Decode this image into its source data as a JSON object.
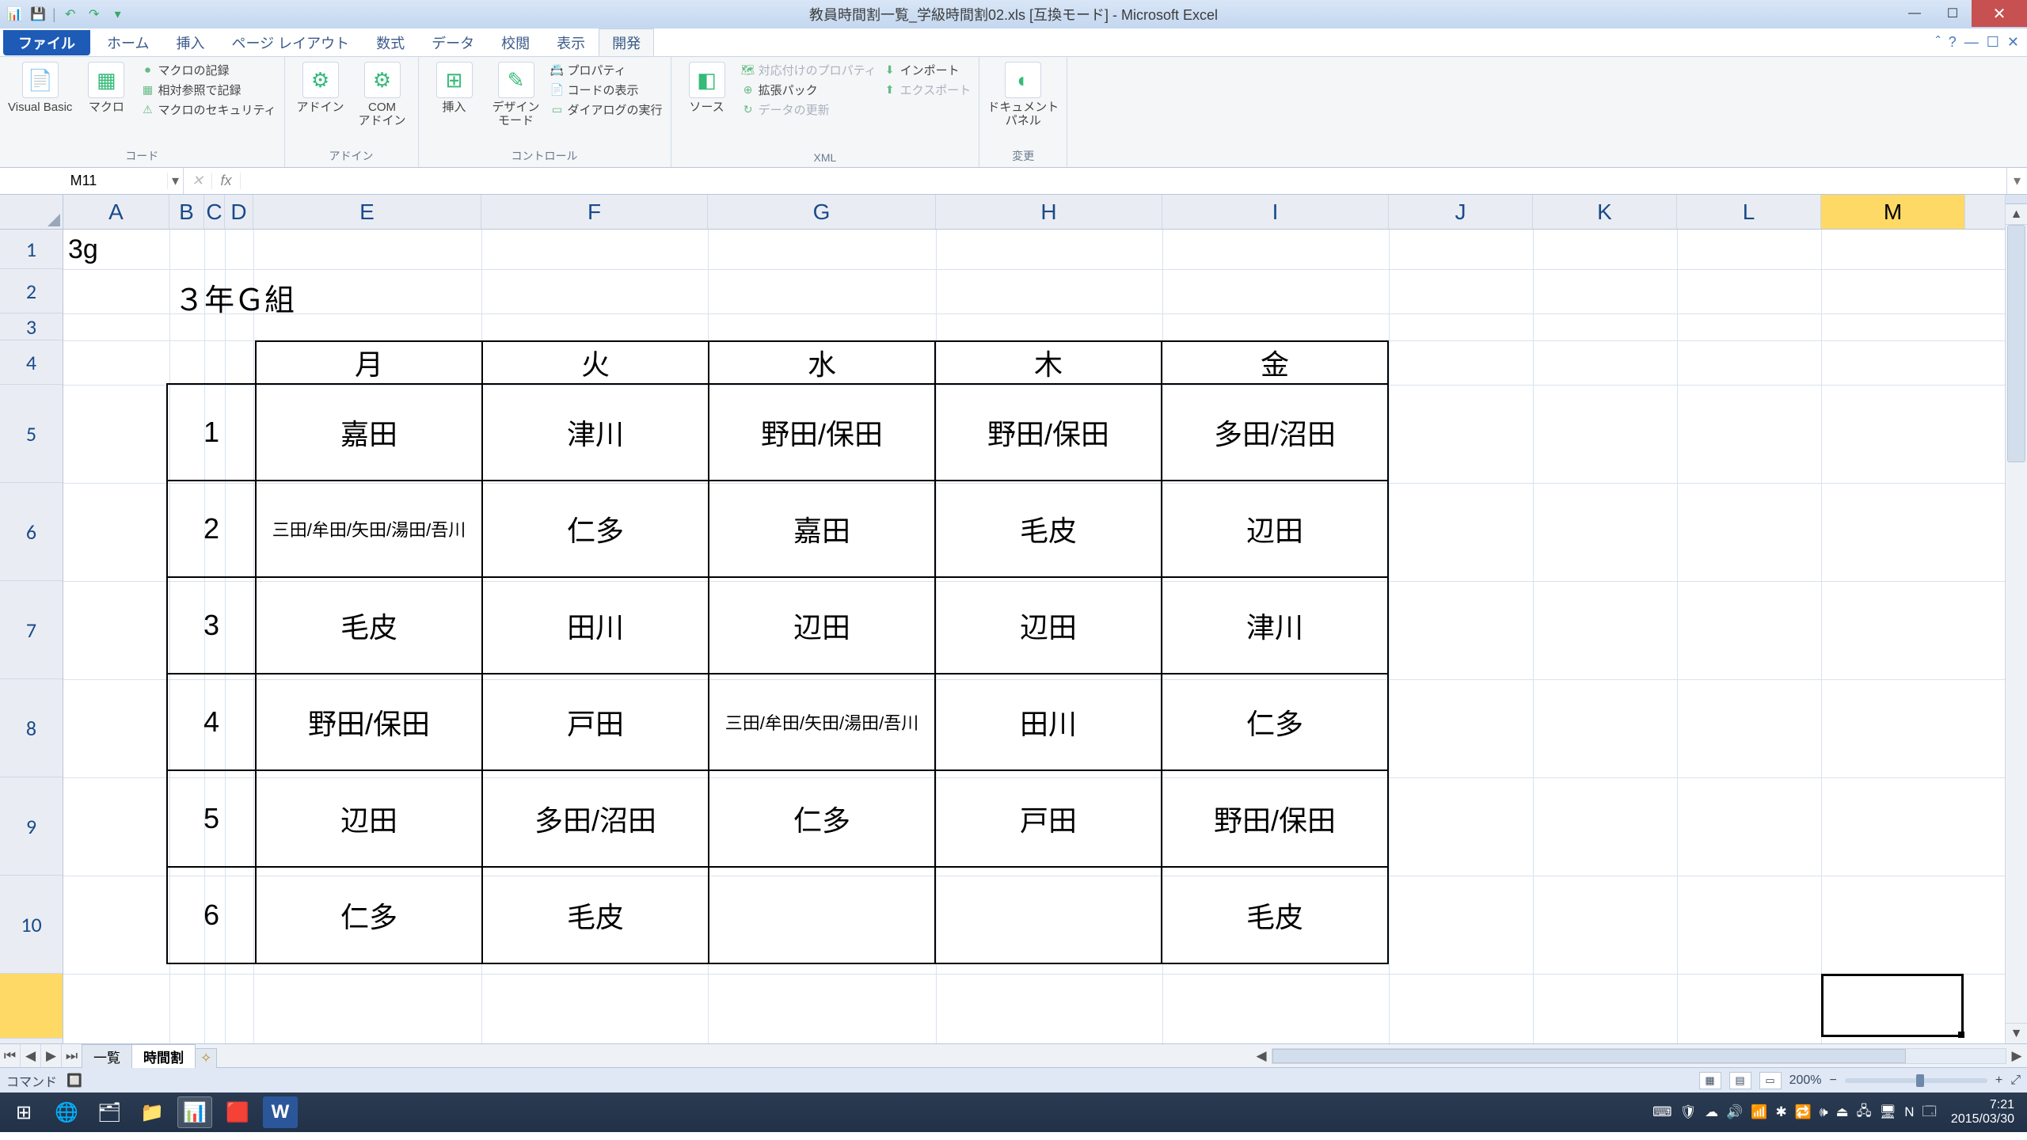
{
  "title": "教員時間割一覧_学級時間割02.xls  [互換モード] - Microsoft Excel",
  "qat": {
    "save": "💾",
    "undo": "↶",
    "redo": "↷",
    "more": "▾"
  },
  "win": {
    "min": "—",
    "max": "☐",
    "close": "✕"
  },
  "tabs": {
    "file": "ファイル",
    "items": [
      "ホーム",
      "挿入",
      "ページ レイアウト",
      "数式",
      "データ",
      "校閲",
      "表示",
      "開発"
    ],
    "active_index": 7
  },
  "ribbon_right": {
    "help": "?",
    "min": "▲",
    "restore": "☐",
    "close": "✕"
  },
  "ribbon": {
    "groups": [
      {
        "label": "コード",
        "big": [
          {
            "icon": "📄",
            "label": "Visual Basic"
          },
          {
            "icon": "▦",
            "label": "マクロ"
          }
        ],
        "stack": [
          "マクロの記録",
          "相対参照で記録",
          "マクロのセキュリティ"
        ]
      },
      {
        "label": "アドイン",
        "big": [
          {
            "icon": "⚙",
            "label": "アドイン"
          },
          {
            "icon": "⚙",
            "label": "COM\nアドイン"
          }
        ]
      },
      {
        "label": "コントロール",
        "big": [
          {
            "icon": "⊞",
            "label": "挿入"
          },
          {
            "icon": "✎",
            "label": "デザイン\nモード"
          }
        ],
        "stack": [
          "プロパティ",
          "コードの表示",
          "ダイアログの実行"
        ]
      },
      {
        "label": "XML",
        "big": [
          {
            "icon": "◧",
            "label": "ソース"
          }
        ],
        "stack": [
          "対応付けのプロパティ",
          "拡張パック",
          "データの更新"
        ],
        "stack2": [
          "インポート",
          "エクスポート"
        ]
      },
      {
        "label": "変更",
        "big": [
          {
            "icon": "◐",
            "label": "ドキュメント\nパネル"
          }
        ]
      }
    ]
  },
  "namebox": "M11",
  "formula": "",
  "fx_label": "fx",
  "columns": [
    "A",
    "B",
    "C",
    "D",
    "E",
    "F",
    "G",
    "H",
    "I",
    "J",
    "K",
    "L",
    "M"
  ],
  "rows": [
    "1",
    "2",
    "3",
    "4",
    "5",
    "6",
    "7",
    "8",
    "9",
    "10"
  ],
  "row11": "",
  "a1": "3g",
  "b2": "３年Ｇ組",
  "timetable": {
    "days": [
      "月",
      "火",
      "水",
      "木",
      "金"
    ],
    "periods": [
      "1",
      "2",
      "3",
      "4",
      "5",
      "6"
    ],
    "cells": [
      [
        "嘉田",
        "津川",
        "野田/保田",
        "野田/保田",
        "多田/沼田"
      ],
      [
        "三田/牟田/矢田/湯田/吾川",
        "仁多",
        "嘉田",
        "毛皮",
        "辺田"
      ],
      [
        "毛皮",
        "田川",
        "辺田",
        "辺田",
        "津川"
      ],
      [
        "野田/保田",
        "戸田",
        "三田/牟田/矢田/湯田/吾川",
        "田川",
        "仁多"
      ],
      [
        "辺田",
        "多田/沼田",
        "仁多",
        "戸田",
        "野田/保田"
      ],
      [
        "仁多",
        "毛皮",
        "",
        "",
        "毛皮"
      ]
    ]
  },
  "sheet_tabs": {
    "items": [
      "一覧",
      "時間割"
    ],
    "active_index": 1,
    "insert": "✧"
  },
  "sheet_nav": [
    "⏮",
    "◀",
    "▶",
    "⏭"
  ],
  "status": {
    "left": "コマンド",
    "icon": "🔲",
    "views": [
      "▦",
      "▤",
      "▭"
    ],
    "zoom": "200%",
    "minus": "−",
    "plus": "+",
    "expand": "⤢"
  },
  "taskbar": {
    "apps": [
      {
        "icon": "⊞",
        "name": "start"
      },
      {
        "icon": "🌐",
        "name": "ie"
      },
      {
        "icon": "🗂",
        "name": "lib"
      },
      {
        "icon": "📁",
        "name": "explorer"
      },
      {
        "icon": "📊",
        "name": "excel",
        "active": true
      },
      {
        "icon": "🟥",
        "name": "app"
      },
      {
        "icon": "W",
        "name": "word"
      }
    ],
    "tray": [
      "⌨",
      "🛡",
      "☁",
      "🔊",
      "📶",
      "✱",
      "🔁",
      "🕪",
      "⏏",
      "🖧",
      "🖥",
      "N",
      "🗔"
    ],
    "time": "7:21",
    "date": "2015/03/30"
  }
}
